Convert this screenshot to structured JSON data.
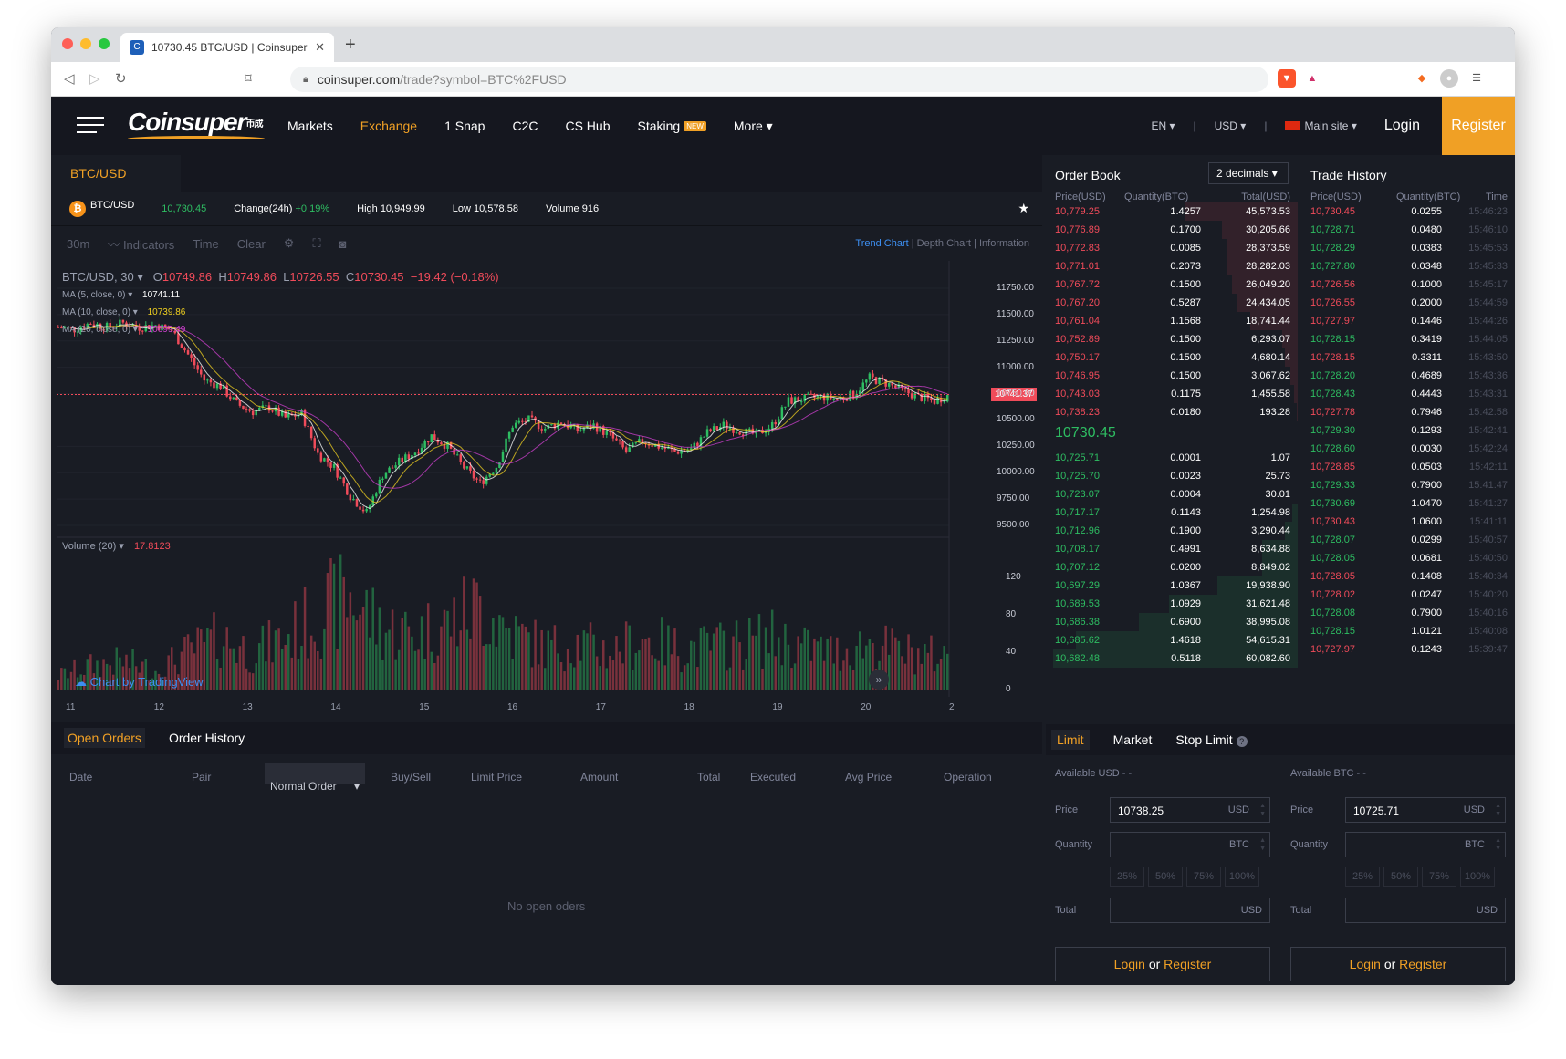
{
  "browser": {
    "tab_title": "10730.45 BTC/USD | Coinsuper",
    "url_domain": "coinsuper.com",
    "url_path": "/trade?symbol=BTC%2FUSD",
    "colors": {
      "close": "#fe5f57",
      "min": "#febc2e",
      "max": "#28c840"
    }
  },
  "header": {
    "logo_text": "Coinsuper",
    "logo_sub": "币成",
    "nav": [
      "Markets",
      "Exchange",
      "1 Snap",
      "C2C",
      "CS Hub",
      "Staking",
      "More"
    ],
    "staking_badge": "NEW",
    "lang": "EN",
    "currency": "USD",
    "site": "Main site",
    "login": "Login",
    "register": "Register"
  },
  "pair_tab": "BTC/USD",
  "ticker": {
    "pair": "BTC/USD",
    "last": "10,730.45",
    "change_label": "Change(24h)",
    "change": "+0.19%",
    "high_label": "High",
    "high": "10,949.99",
    "low_label": "Low",
    "low": "10,578.58",
    "volume_label": "Volume",
    "volume": "916"
  },
  "toolbar": {
    "interval": "30m",
    "indicators": "Indicators",
    "time": "Time",
    "clear": "Clear",
    "trend_chart": "Trend Chart",
    "depth_chart": "Depth Chart",
    "information": "Information"
  },
  "chart_legend": {
    "symbol": "BTC/USD, 30",
    "o_label": "O",
    "o": "10749.86",
    "h_label": "H",
    "h": "10749.86",
    "l_label": "L",
    "l": "10726.55",
    "c_label": "C",
    "c": "10730.45",
    "change": "−19.42 (−0.18%)",
    "ma5": "MA (5, close, 0)",
    "ma5_val": "10741.11",
    "ma10": "MA (10, close, 0)",
    "ma10_val": "10739.86",
    "ma20": "MA (20, close, 0)",
    "ma20_val": "10699.49",
    "volume": "Volume (20)",
    "volume_val": "17.8123",
    "price_badge": "10741.37",
    "tradingview": "Chart by TradingView"
  },
  "chart_data": {
    "type": "candlestick",
    "x_tick_labels": [
      "11",
      "12",
      "13",
      "14",
      "15",
      "16",
      "17",
      "18",
      "19",
      "20",
      "2"
    ],
    "price_ticks": [
      "11750.00",
      "11500.00",
      "11250.00",
      "11000.00",
      "10750.00",
      "10500.00",
      "10250.00",
      "10000.00",
      "9750.00",
      "9500.00"
    ],
    "ylim": [
      9500,
      11750
    ],
    "volume_ticks": [
      "120",
      "80",
      "40",
      "0"
    ],
    "volume_ylim": [
      0,
      150
    ],
    "close_path": [
      [
        0,
        11380
      ],
      [
        5,
        11360
      ],
      [
        10,
        11420
      ],
      [
        15,
        11380
      ],
      [
        20,
        11420
      ],
      [
        25,
        11380
      ],
      [
        30,
        11400
      ],
      [
        35,
        11350
      ],
      [
        40,
        11120
      ],
      [
        45,
        10880
      ],
      [
        50,
        10820
      ],
      [
        55,
        10650
      ],
      [
        60,
        10580
      ],
      [
        65,
        10620
      ],
      [
        70,
        10520
      ],
      [
        75,
        10560
      ],
      [
        80,
        10180
      ],
      [
        85,
        10050
      ],
      [
        90,
        9780
      ],
      [
        95,
        9620
      ],
      [
        100,
        9980
      ],
      [
        105,
        10100
      ],
      [
        110,
        10200
      ],
      [
        115,
        10350
      ],
      [
        120,
        10250
      ],
      [
        125,
        10050
      ],
      [
        130,
        9900
      ],
      [
        135,
        10060
      ],
      [
        140,
        10450
      ],
      [
        145,
        10500
      ],
      [
        150,
        10420
      ],
      [
        155,
        10480
      ],
      [
        160,
        10400
      ],
      [
        165,
        10450
      ],
      [
        170,
        10350
      ],
      [
        175,
        10200
      ],
      [
        180,
        10300
      ],
      [
        185,
        10250
      ],
      [
        190,
        10200
      ],
      [
        195,
        10220
      ],
      [
        200,
        10380
      ],
      [
        205,
        10450
      ],
      [
        210,
        10400
      ],
      [
        215,
        10360
      ],
      [
        220,
        10450
      ],
      [
        225,
        10680
      ],
      [
        230,
        10700
      ],
      [
        235,
        10720
      ],
      [
        240,
        10700
      ],
      [
        245,
        10740
      ],
      [
        250,
        10900
      ],
      [
        255,
        10850
      ],
      [
        260,
        10780
      ],
      [
        265,
        10720
      ],
      [
        270,
        10680
      ],
      [
        274,
        10730
      ]
    ],
    "volume_profile": [
      [
        0,
        15
      ],
      [
        10,
        25
      ],
      [
        20,
        30
      ],
      [
        30,
        20
      ],
      [
        40,
        40
      ],
      [
        50,
        55
      ],
      [
        60,
        40
      ],
      [
        70,
        55
      ],
      [
        80,
        80
      ],
      [
        90,
        100
      ],
      [
        100,
        65
      ],
      [
        110,
        60
      ],
      [
        120,
        70
      ],
      [
        130,
        90
      ],
      [
        140,
        60
      ],
      [
        150,
        45
      ],
      [
        160,
        50
      ],
      [
        170,
        40
      ],
      [
        180,
        55
      ],
      [
        190,
        45
      ],
      [
        200,
        45
      ],
      [
        210,
        50
      ],
      [
        220,
        55
      ],
      [
        230,
        45
      ],
      [
        240,
        40
      ],
      [
        250,
        50
      ],
      [
        260,
        40
      ],
      [
        274,
        35
      ]
    ],
    "up_color": "#2ebd62",
    "down_color": "#f04b5a",
    "ma_colors": [
      "#ffffff",
      "#f0d020",
      "#d040d0"
    ]
  },
  "orders": {
    "tab_open": "Open Orders",
    "tab_history": "Order History",
    "cols": [
      "Date",
      "Pair",
      "Buy/Sell",
      "Limit Price",
      "Amount",
      "Total",
      "Executed",
      "Avg Price",
      "Operation"
    ],
    "type_select": "Normal Order",
    "empty": "No open oders"
  },
  "orderbook": {
    "title": "Order Book",
    "decimals": "2 decimals",
    "col_price": "Price(USD)",
    "col_qty": "Quantity(BTC)",
    "col_total": "Total(USD)",
    "asks": [
      [
        "10,779.25",
        "1.4257",
        "45,573.53",
        0.45
      ],
      [
        "10,776.89",
        "0.1700",
        "30,205.66",
        0.3
      ],
      [
        "10,772.83",
        "0.0085",
        "28,373.59",
        0.28
      ],
      [
        "10,771.01",
        "0.2073",
        "28,282.03",
        0.28
      ],
      [
        "10,767.72",
        "0.1500",
        "26,049.20",
        0.26
      ],
      [
        "10,767.20",
        "0.5287",
        "24,434.05",
        0.24
      ],
      [
        "10,761.04",
        "1.1568",
        "18,741.44",
        0.19
      ],
      [
        "10,752.89",
        "0.1500",
        "6,293.07",
        0.06
      ],
      [
        "10,750.17",
        "0.1500",
        "4,680.14",
        0.05
      ],
      [
        "10,746.95",
        "0.1500",
        "3,067.62",
        0.03
      ],
      [
        "10,743.03",
        "0.1175",
        "1,455.58",
        0.015
      ],
      [
        "10,738.23",
        "0.0180",
        "193.28",
        0.002
      ]
    ],
    "last_price": "10730.45",
    "bids": [
      [
        "10,725.71",
        "0.0001",
        "1.07",
        0.0
      ],
      [
        "10,725.70",
        "0.0023",
        "25.73",
        0.0
      ],
      [
        "10,723.07",
        "0.0004",
        "30.01",
        0.0
      ],
      [
        "10,717.17",
        "0.1143",
        "1,254.98",
        0.02
      ],
      [
        "10,712.96",
        "0.1900",
        "3,290.44",
        0.05
      ],
      [
        "10,708.17",
        "0.4991",
        "8,634.88",
        0.14
      ],
      [
        "10,707.12",
        "0.0200",
        "8,849.02",
        0.14
      ],
      [
        "10,697.29",
        "1.0367",
        "19,938.90",
        0.32
      ],
      [
        "10,689.53",
        "1.0929",
        "31,621.48",
        0.51
      ],
      [
        "10,686.38",
        "0.6900",
        "38,995.08",
        0.63
      ],
      [
        "10,685.62",
        "1.4618",
        "54,615.31",
        0.88
      ],
      [
        "10,682.48",
        "0.5118",
        "60,082.60",
        0.97
      ]
    ]
  },
  "trade_history": {
    "title": "Trade History",
    "col_price": "Price(USD)",
    "col_qty": "Quantity(BTC)",
    "col_time": "Time",
    "rows": [
      [
        "10,730.45",
        "0.0255",
        "15:46:23",
        "down"
      ],
      [
        "10,728.71",
        "0.0480",
        "15:46:10",
        "up"
      ],
      [
        "10,728.29",
        "0.0383",
        "15:45:53",
        "up"
      ],
      [
        "10,727.80",
        "0.0348",
        "15:45:33",
        "up"
      ],
      [
        "10,726.56",
        "0.1000",
        "15:45:17",
        "down"
      ],
      [
        "10,726.55",
        "0.2000",
        "15:44:59",
        "down"
      ],
      [
        "10,727.97",
        "0.1446",
        "15:44:26",
        "down"
      ],
      [
        "10,728.15",
        "0.3419",
        "15:44:05",
        "up"
      ],
      [
        "10,728.15",
        "0.3311",
        "15:43:50",
        "down"
      ],
      [
        "10,728.20",
        "0.4689",
        "15:43:36",
        "up"
      ],
      [
        "10,728.43",
        "0.4443",
        "15:43:31",
        "up"
      ],
      [
        "10,727.78",
        "0.7946",
        "15:42:58",
        "down"
      ],
      [
        "10,729.30",
        "0.1293",
        "15:42:41",
        "up"
      ],
      [
        "10,728.60",
        "0.0030",
        "15:42:24",
        "up"
      ],
      [
        "10,728.85",
        "0.0503",
        "15:42:11",
        "down"
      ],
      [
        "10,729.33",
        "0.7900",
        "15:41:47",
        "up"
      ],
      [
        "10,730.69",
        "1.0470",
        "15:41:27",
        "up"
      ],
      [
        "10,730.43",
        "1.0600",
        "15:41:11",
        "down"
      ],
      [
        "10,728.07",
        "0.0299",
        "15:40:57",
        "up"
      ],
      [
        "10,728.05",
        "0.0681",
        "15:40:50",
        "up"
      ],
      [
        "10,728.05",
        "0.1408",
        "15:40:34",
        "down"
      ],
      [
        "10,728.02",
        "0.0247",
        "15:40:20",
        "down"
      ],
      [
        "10,728.08",
        "0.7900",
        "15:40:16",
        "up"
      ],
      [
        "10,728.15",
        "1.0121",
        "15:40:08",
        "up"
      ],
      [
        "10,727.97",
        "0.1243",
        "15:39:47",
        "down"
      ]
    ]
  },
  "trade_form": {
    "tab_limit": "Limit",
    "tab_market": "Market",
    "tab_stop": "Stop Limit",
    "buy": {
      "available": "Available USD - -",
      "price": "10738.25"
    },
    "sell": {
      "available": "Available BTC - -",
      "price": "10725.71"
    },
    "price_label": "Price",
    "qty_label": "Quantity",
    "total_label": "Total",
    "unit_usd": "USD",
    "unit_btc": "BTC",
    "pcts": [
      "25%",
      "50%",
      "75%",
      "100%"
    ],
    "login": "Login",
    "or": "or",
    "register": "Register"
  }
}
